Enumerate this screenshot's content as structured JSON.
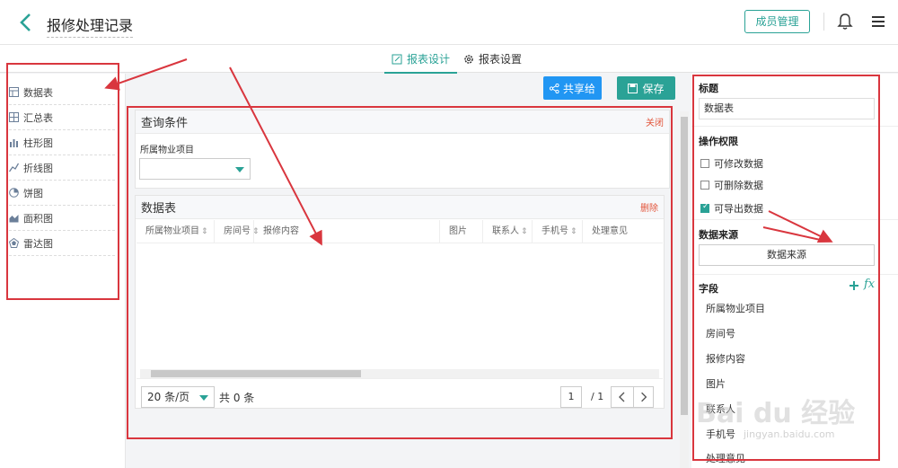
{
  "header": {
    "title": "报修处理记录",
    "member_button": "成员管理"
  },
  "tabs": [
    {
      "label": "报表设计",
      "active": true
    },
    {
      "label": "报表设置",
      "active": false
    }
  ],
  "sidebar": {
    "items": [
      {
        "label": "数据表",
        "icon": "table-icon"
      },
      {
        "label": "汇总表",
        "icon": "summary-table-icon"
      },
      {
        "label": "柱形图",
        "icon": "bar-chart-icon"
      },
      {
        "label": "折线图",
        "icon": "line-chart-icon"
      },
      {
        "label": "饼图",
        "icon": "pie-chart-icon"
      },
      {
        "label": "面积图",
        "icon": "area-chart-icon"
      },
      {
        "label": "雷达图",
        "icon": "radar-chart-icon"
      }
    ]
  },
  "toolbar": {
    "share_label": "共享给",
    "save_label": "保存"
  },
  "query": {
    "title": "查询条件",
    "close_label": "关闭",
    "field_label": "所属物业项目",
    "field_value": ""
  },
  "table": {
    "title": "数据表",
    "delete_label": "删除",
    "columns": [
      "所属物业项目",
      "房间号",
      "报修内容",
      "图片",
      "联系人",
      "手机号",
      "处理意见"
    ],
    "page_size": "20 条/页",
    "total": "共 0 条",
    "page": "1",
    "page_total": "/ 1"
  },
  "right": {
    "title_label": "标题",
    "title_value": "数据表",
    "perm_label": "操作权限",
    "perms": [
      {
        "label": "可修改数据",
        "checked": false
      },
      {
        "label": "可删除数据",
        "checked": false
      },
      {
        "label": "可导出数据",
        "checked": true
      }
    ],
    "ds_label": "数据来源",
    "ds_button": "数据来源",
    "fields_label": "字段",
    "fields": [
      "所属物业项目",
      "房间号",
      "报修内容",
      "图片",
      "联系人",
      "手机号",
      "处理意见"
    ]
  },
  "watermark": {
    "logo": "Bai du 经验",
    "url": "jingyan.baidu.com"
  },
  "colors": {
    "accent": "#2aa296",
    "share": "#2196f3",
    "annotation": "#d9363e"
  }
}
